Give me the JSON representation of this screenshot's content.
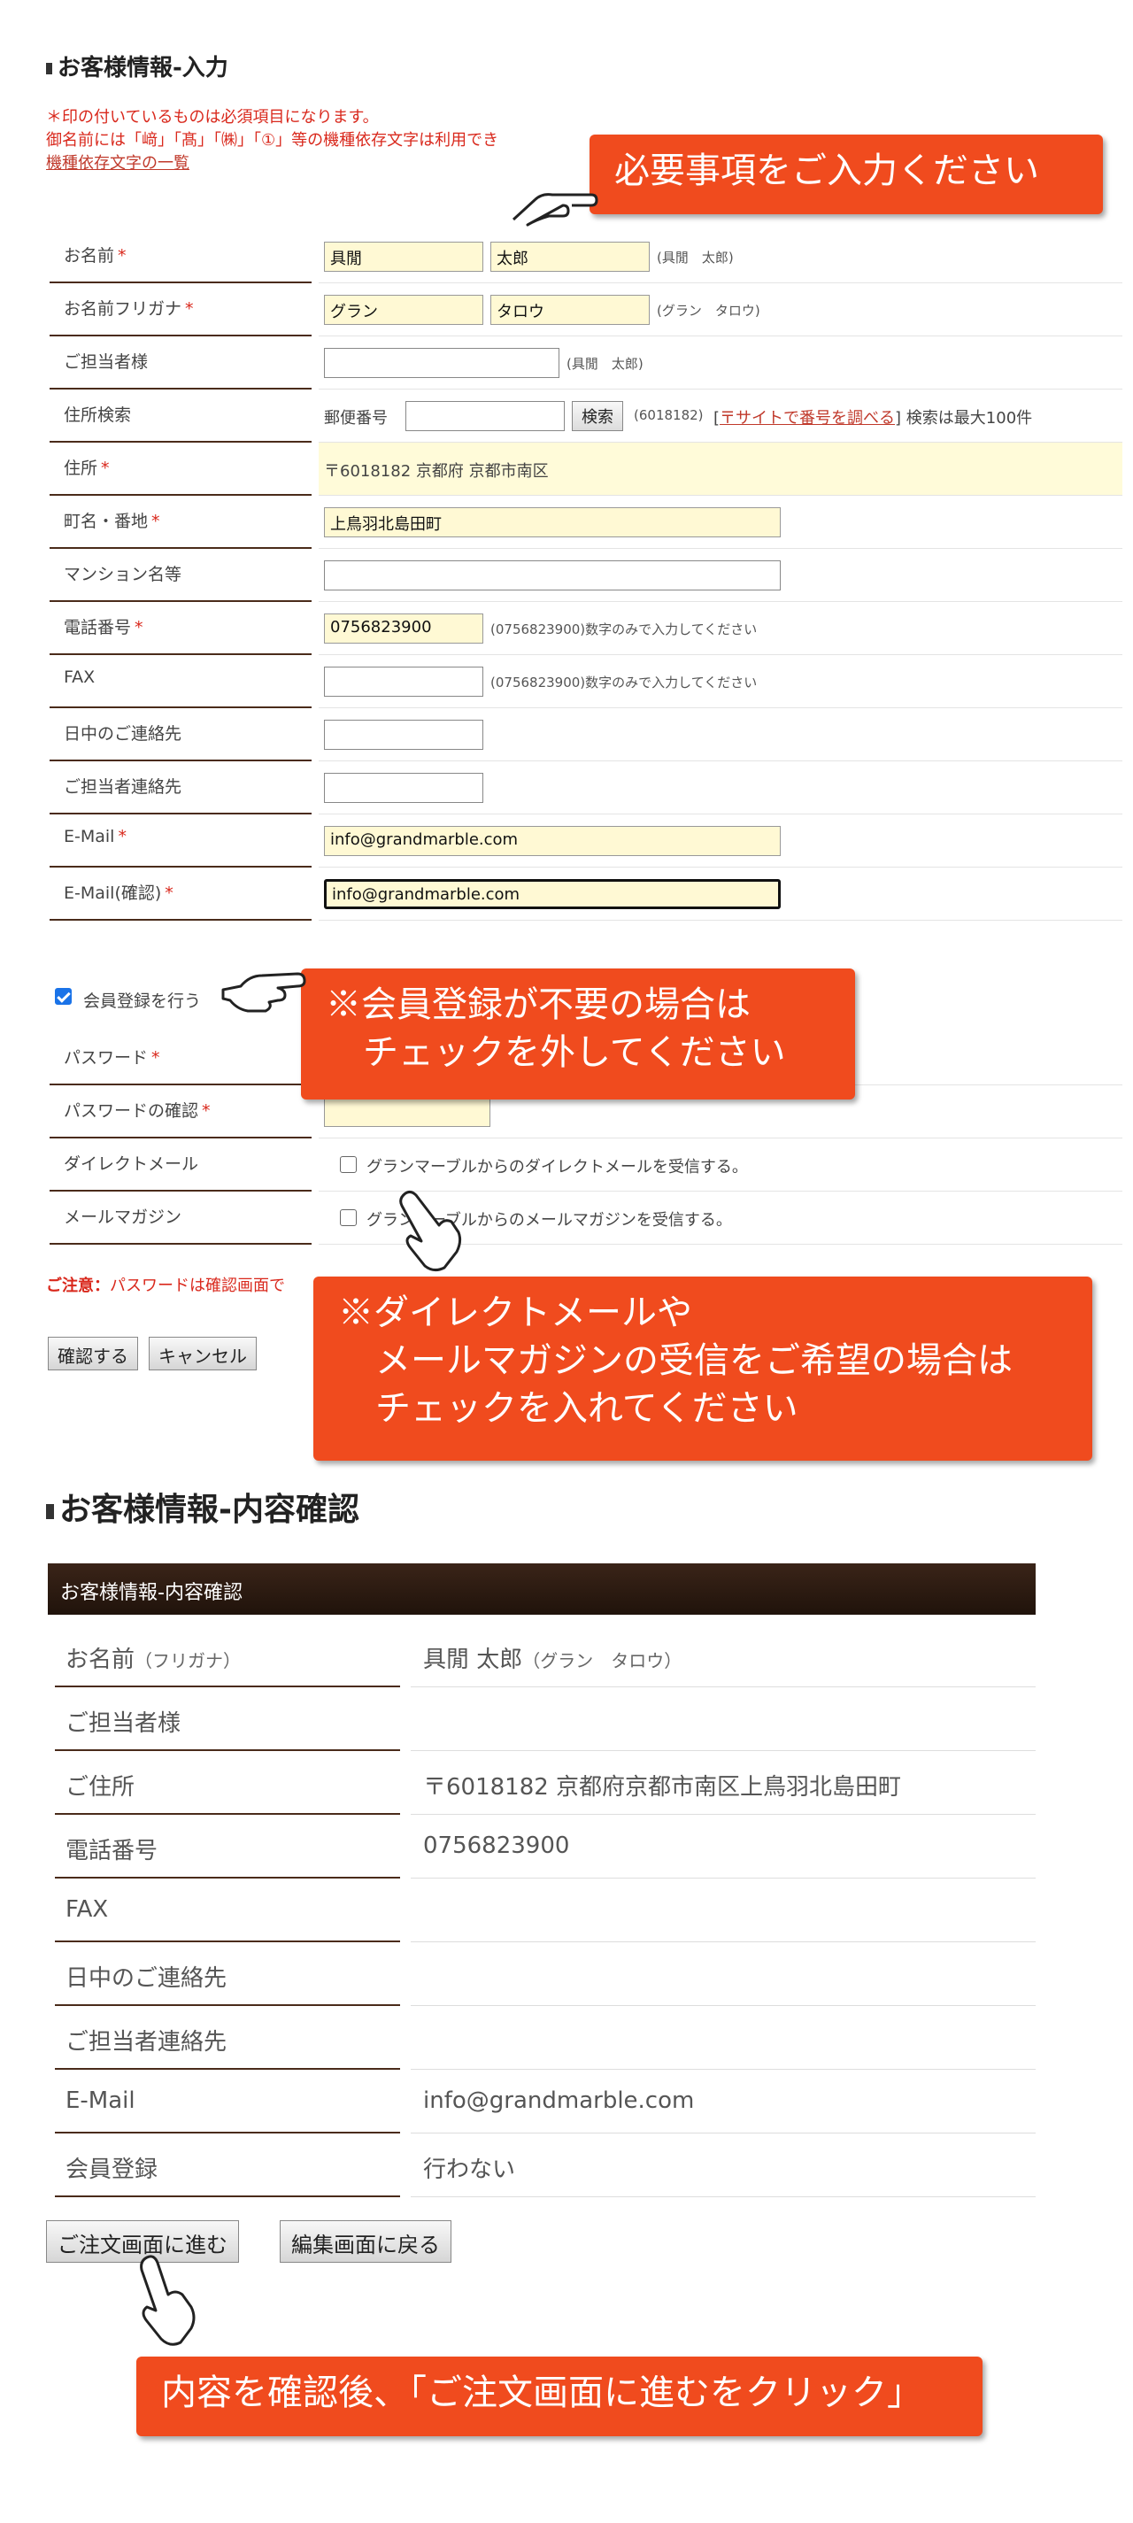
{
  "input_section": {
    "title": "お客様情報-入力",
    "note_1": "＊印の付いているものは必須項目になります。",
    "note_2": "御名前には「﨑」「髙」「㈱」「①」等の機種依存文字は利用でき",
    "note_link": "機種依存文字の一覧"
  },
  "form": {
    "name": {
      "label": "お名前",
      "req": "*",
      "last": "具閒",
      "first": "太郎",
      "hint": "(具閒　太郎)"
    },
    "kana": {
      "label": "お名前フリガナ",
      "req": "*",
      "last": "グラン",
      "first": "タロウ",
      "hint": "(グラン　タロウ)"
    },
    "contact": {
      "label": "ご担当者様",
      "value": "",
      "hint": "(具閒　太郎)"
    },
    "address_search": {
      "label": "住所検索",
      "postal_label": "郵便番号",
      "value": "",
      "search_button": "検索",
      "hint": "(6018182)",
      "link": "〒サイトで番号を調べる",
      "bracket_open": "[",
      "bracket_close": "]",
      "limit": "検索は最大100件"
    },
    "address": {
      "label": "住所",
      "req": "*",
      "value": "〒6018182 京都府 京都市南区"
    },
    "street": {
      "label": "町名・番地",
      "req": "*",
      "value": "上鳥羽北島田町"
    },
    "building": {
      "label": "マンション名等",
      "value": ""
    },
    "phone": {
      "label": "電話番号",
      "req": "*",
      "value": "0756823900",
      "hint": "(0756823900)数字のみで入力してください"
    },
    "fax": {
      "label": "FAX",
      "value": "",
      "hint": "(0756823900)数字のみで入力してください"
    },
    "day_contact": {
      "label": "日中のご連絡先",
      "value": ""
    },
    "contact_phone": {
      "label": "ご担当者連絡先",
      "value": ""
    },
    "email": {
      "label": "E-Mail",
      "req": "*",
      "value": "info@grandmarble.com"
    },
    "email_confirm": {
      "label": "E-Mail(確認)",
      "req": "*",
      "value": "info@grandmarble.com"
    }
  },
  "member": {
    "checkbox_label": "会員登録を行う",
    "checked": true,
    "password": {
      "label": "パスワード",
      "req": "*"
    },
    "password_confirm": {
      "label": "パスワードの確認",
      "req": "*"
    },
    "direct_mail": {
      "label": "ダイレクトメール",
      "text": "グランマーブルからのダイレクトメールを受信する。"
    },
    "newsletter": {
      "label": "メールマガジン",
      "text": "グランマーブルからのメールマガジンを受信する。"
    }
  },
  "caution": {
    "bold": "ご注意：",
    "text": "パスワードは確認画面で"
  },
  "buttons": {
    "confirm": "確認する",
    "cancel": "キャンセル",
    "proceed": "ご注文画面に進む",
    "back": "編集画面に戻る"
  },
  "callouts": {
    "c1": "必要事項をご入力ください",
    "c2_line1": "※会員登録が不要の場合は",
    "c2_line2": "チェックを外してください",
    "c3_line1": "※ダイレクトメールや",
    "c3_line2": "メールマガジンの受信をご希望の場合は",
    "c3_line3": "チェックを入れてください",
    "c4": "内容を確認後、「ご注文画面に進むをクリック」"
  },
  "confirm_section": {
    "title": "お客様情報-内容確認",
    "bar_title": "お客様情報-内容確認",
    "rows": [
      {
        "label": "お名前",
        "label_sub": "（フリガナ）",
        "value": "具閒 太郎",
        "value_sub": "（グラン　タロウ）"
      },
      {
        "label": "ご担当者様",
        "value": ""
      },
      {
        "label": "ご住所",
        "value": "〒6018182 京都府京都市南区上鳥羽北島田町"
      },
      {
        "label": "電話番号",
        "value": "0756823900"
      },
      {
        "label": "FAX",
        "value": ""
      },
      {
        "label": "日中のご連絡先",
        "value": ""
      },
      {
        "label": "ご担当者連絡先",
        "value": ""
      },
      {
        "label": "E-Mail",
        "value": "info@grandmarble.com"
      },
      {
        "label": "会員登録",
        "value": "行わない"
      }
    ]
  },
  "colors": {
    "callout": "#f04b1e",
    "required": "#d9281c",
    "header_bar": "#2c1a10",
    "highlight": "#fffbd9"
  }
}
